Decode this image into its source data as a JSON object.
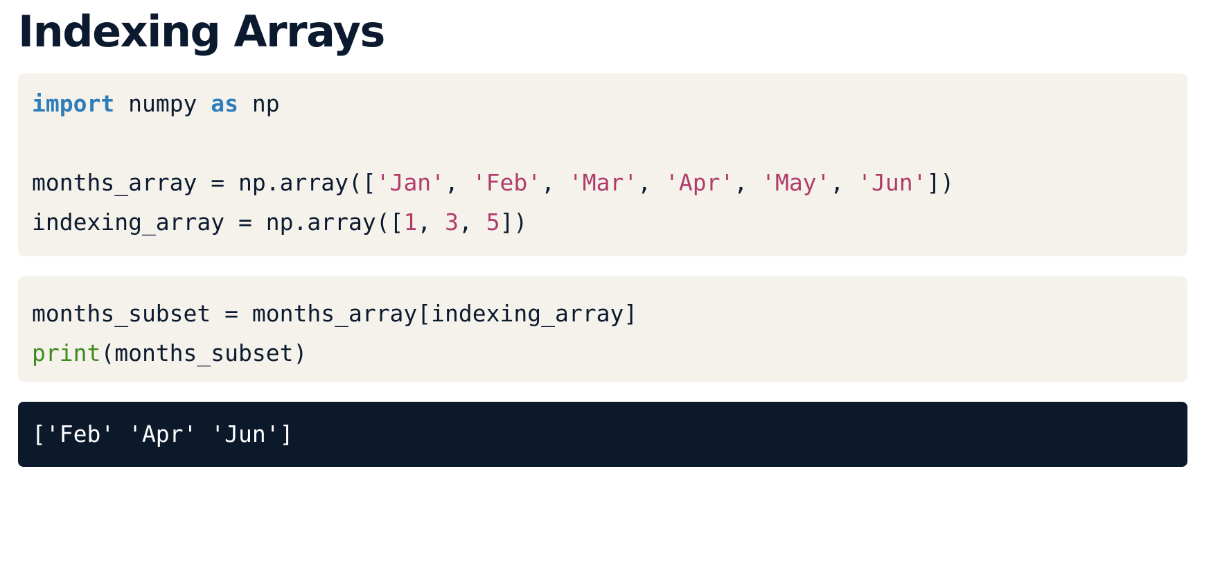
{
  "title": "Indexing Arrays",
  "code_blocks": [
    {
      "lines": [
        [
          {
            "t": "import",
            "c": "kw"
          },
          {
            "t": " numpy ",
            "c": ""
          },
          {
            "t": "as",
            "c": "kw"
          },
          {
            "t": " np",
            "c": ""
          }
        ],
        [],
        [
          {
            "t": "months_array = np.array([",
            "c": ""
          },
          {
            "t": "'Jan'",
            "c": "str"
          },
          {
            "t": ", ",
            "c": ""
          },
          {
            "t": "'Feb'",
            "c": "str"
          },
          {
            "t": ", ",
            "c": ""
          },
          {
            "t": "'Mar'",
            "c": "str"
          },
          {
            "t": ", ",
            "c": ""
          },
          {
            "t": "'Apr'",
            "c": "str"
          },
          {
            "t": ", ",
            "c": ""
          },
          {
            "t": "'May'",
            "c": "str"
          },
          {
            "t": ", ",
            "c": ""
          },
          {
            "t": "'Jun'",
            "c": "str"
          },
          {
            "t": "])",
            "c": ""
          }
        ],
        [
          {
            "t": "indexing_array = np.array([",
            "c": ""
          },
          {
            "t": "1",
            "c": "num"
          },
          {
            "t": ", ",
            "c": ""
          },
          {
            "t": "3",
            "c": "num"
          },
          {
            "t": ", ",
            "c": ""
          },
          {
            "t": "5",
            "c": "num"
          },
          {
            "t": "])",
            "c": ""
          }
        ]
      ]
    },
    {
      "lines": [
        [
          {
            "t": "months_subset = months_array[indexing_array]",
            "c": ""
          }
        ],
        [
          {
            "t": "print",
            "c": "fn"
          },
          {
            "t": "(months_subset)",
            "c": ""
          }
        ]
      ]
    }
  ],
  "output": {
    "text": "['Feb' 'Apr' 'Jun']"
  },
  "colors": {
    "keyword": "#2e7dba",
    "string": "#b13b6b",
    "builtin": "#3f8a1f",
    "code_background": "#f5f2ec",
    "output_background": "#0b192b"
  }
}
